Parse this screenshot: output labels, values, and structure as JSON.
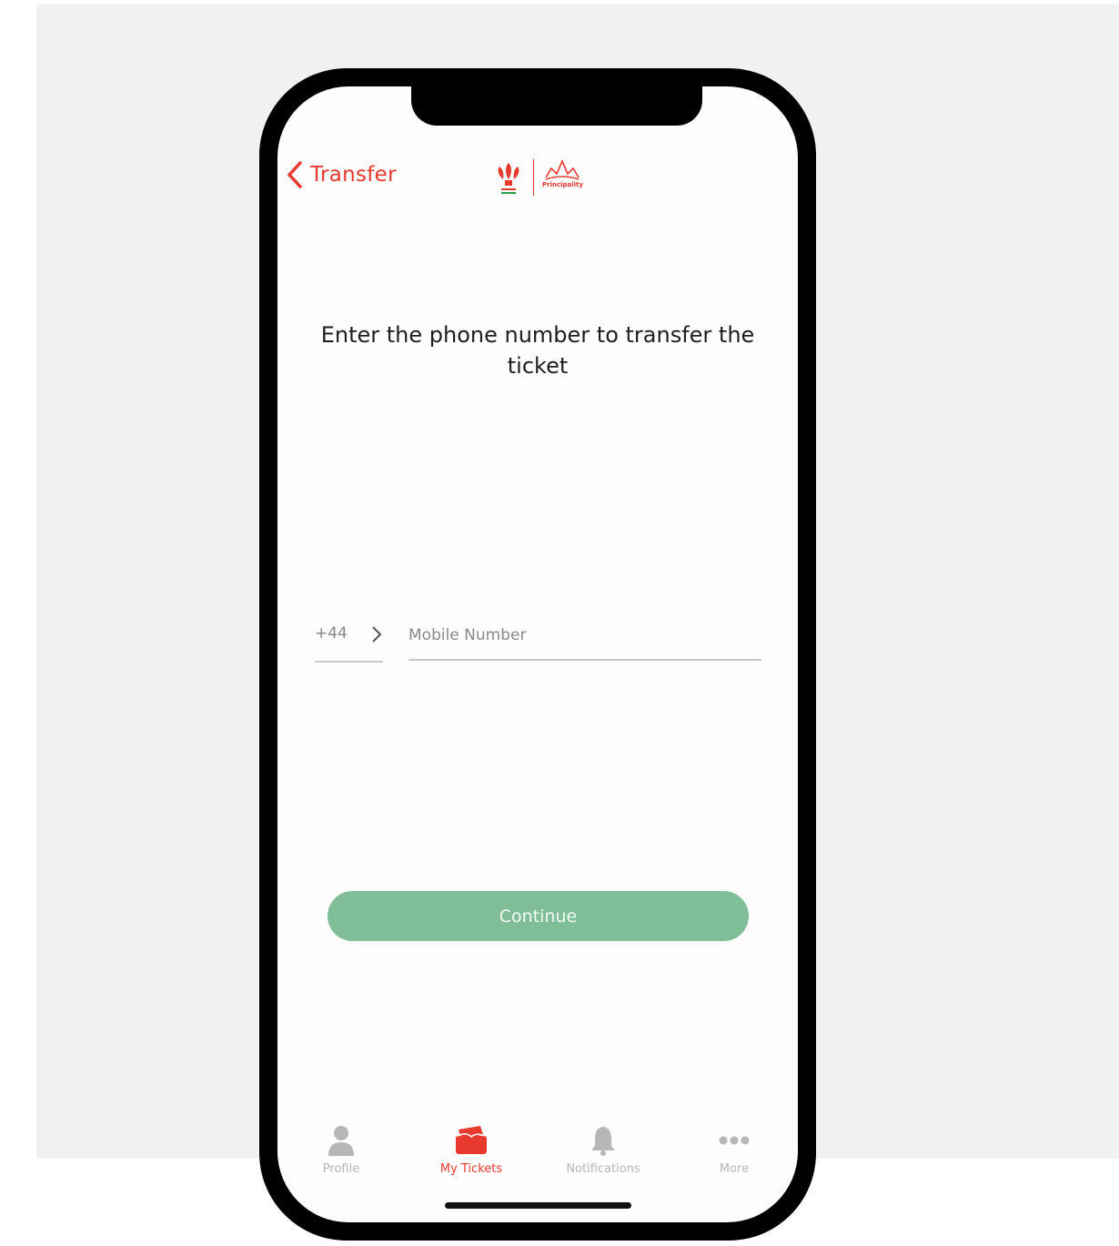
{
  "header": {
    "back_label": "Transfer",
    "logo_text": "Principality"
  },
  "prompt": "Enter the phone number to transfer the ticket",
  "phone_input": {
    "country_code": "+44",
    "placeholder": "Mobile Number",
    "value": ""
  },
  "continue_label": "Continue",
  "tabs": [
    {
      "label": "Profile",
      "icon": "person-icon",
      "active": false
    },
    {
      "label": "My Tickets",
      "icon": "tickets-icon",
      "active": true
    },
    {
      "label": "Notifications",
      "icon": "bell-icon",
      "active": false
    },
    {
      "label": "More",
      "icon": "more-icon",
      "active": false
    }
  ],
  "colors": {
    "accent": "#e8392f",
    "button": "#7fbe96",
    "inactive": "#b7b7b7"
  }
}
